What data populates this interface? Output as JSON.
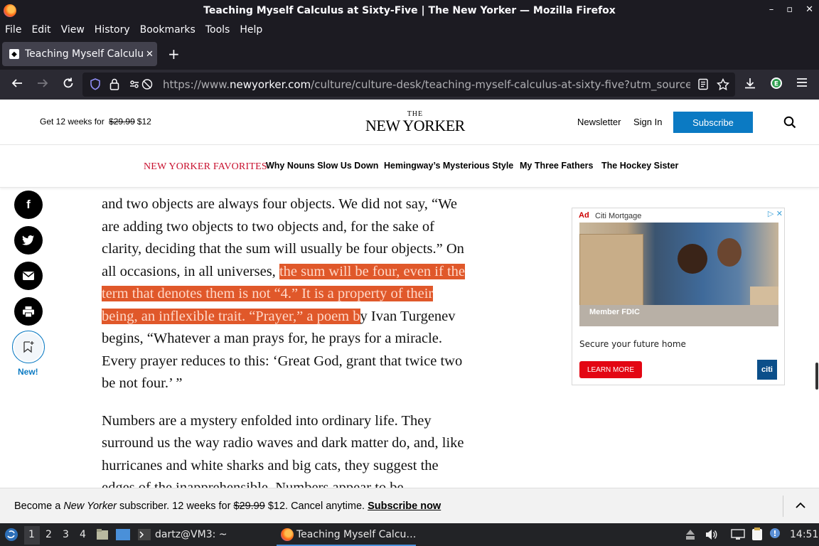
{
  "window": {
    "title": "Teaching Myself Calculus at Sixty-Five | The New Yorker — Mozilla Firefox",
    "controls": [
      "–",
      "▫",
      "✕"
    ]
  },
  "menu": [
    "File",
    "Edit",
    "View",
    "History",
    "Bookmarks",
    "Tools",
    "Help"
  ],
  "tab": {
    "title": "Teaching Myself Calculus at Sixty-Five | The New Yorker",
    "close": "✕",
    "new": "+"
  },
  "url": {
    "prefix": "https://www.",
    "domain": "newyorker.com",
    "path": "/culture/culture-desk/teaching-myself-calculus-at-sixty-five?utm_source=pocket"
  },
  "site": {
    "promo_prefix": "Get 12 weeks for",
    "promo_old": "$29.99",
    "promo_new": "$12",
    "logo_the": "THE",
    "logo_name": "NEW YORKER",
    "newsletter": "Newsletter",
    "sign_in": "Sign In",
    "subscribe": "Subscribe"
  },
  "favorites": {
    "label": "NEW YORKER FAVORITES",
    "links": [
      "Why Nouns Slow Us Down",
      "Hemingway’s Mysterious Style",
      "My Three Fathers",
      "The Hockey Sister"
    ]
  },
  "share": {
    "facebook": "f",
    "save_new": "New!"
  },
  "article": {
    "p1_l1": "and two objects are always four objects. We did not say, “We",
    "p1_l2": "are adding two objects to two objects and, for the sake of",
    "p1_l3": "clarity, deciding that the sum will usually be four objects.” On",
    "p1_l4a": "all occasions, in all universes, ",
    "p1_l4b": "the sum will be four, even if the",
    "p1_l5": "term that denotes them is not “4.” It is a property of their",
    "p1_l6a": "being, an inflexible trait. “Prayer,” a poem b",
    "p1_l6b": "y Ivan Turgenev",
    "p1_l7": "begins, “Whatever a man prays for, he prays for a miracle.",
    "p1_l8": "Every prayer reduces to this: ‘Great God, grant that twice two",
    "p1_l9": "be not four.’ ”",
    "p2_l1": "Numbers are a mystery enfolded into ordinary life. They",
    "p2_l2": "surround us the way radio waves and dark matter do, and, like",
    "p2_l3": "hurricanes and white sharks and big cats, they suggest the",
    "p2_l4": "edges of the inapprehensible. Numbers appear to be"
  },
  "ad": {
    "tag": "Ad",
    "advertiser": "Citi Mortgage",
    "member_fdic": "Member FDIC",
    "copy": "Secure your future home",
    "cta": "LEARN MORE",
    "brand": "citi"
  },
  "banner": {
    "prefix": "Become a ",
    "brand": "New Yorker",
    "mid": " subscriber. 12 weeks for ",
    "old": "$29.99",
    "rest": " $12. Cancel anytime. ",
    "link": "Subscribe now"
  },
  "taskbar": {
    "workspaces": [
      "1",
      "2",
      "3",
      "4"
    ],
    "terminal": "dartz@VM3: ~",
    "browser": "Teaching Myself Calcu…",
    "clock": "14:51"
  },
  "colors": {
    "accent": "#0b7ac3",
    "highlight": "#e0582a",
    "favorites_red": "#c8102e"
  }
}
